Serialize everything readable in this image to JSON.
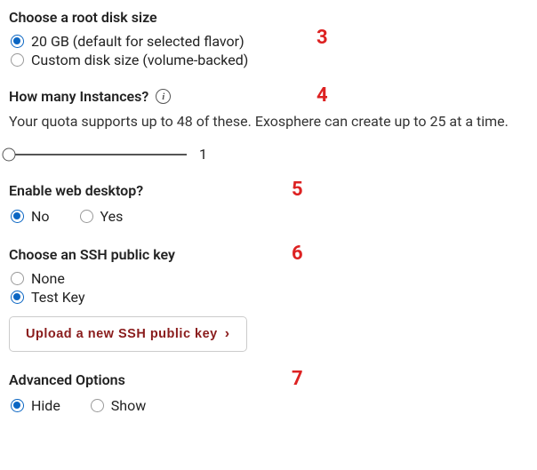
{
  "annotations": {
    "n3": "3",
    "n4": "4",
    "n5": "5",
    "n6": "6",
    "n7": "7"
  },
  "root_disk": {
    "heading": "Choose a root disk size",
    "options": {
      "default": "20 GB (default for selected flavor)",
      "custom": "Custom disk size (volume-backed)"
    }
  },
  "instances": {
    "heading": "How many Instances?",
    "quota_text": "Your quota supports up to 48 of these. Exosphere can create up to 25 at a time.",
    "value": "1"
  },
  "web_desktop": {
    "heading": "Enable web desktop?",
    "no": "No",
    "yes": "Yes"
  },
  "ssh": {
    "heading": "Choose an SSH public key",
    "none": "None",
    "testkey": "Test Key",
    "upload_label": "Upload a new SSH public key"
  },
  "advanced": {
    "heading": "Advanced Options",
    "hide": "Hide",
    "show": "Show"
  }
}
